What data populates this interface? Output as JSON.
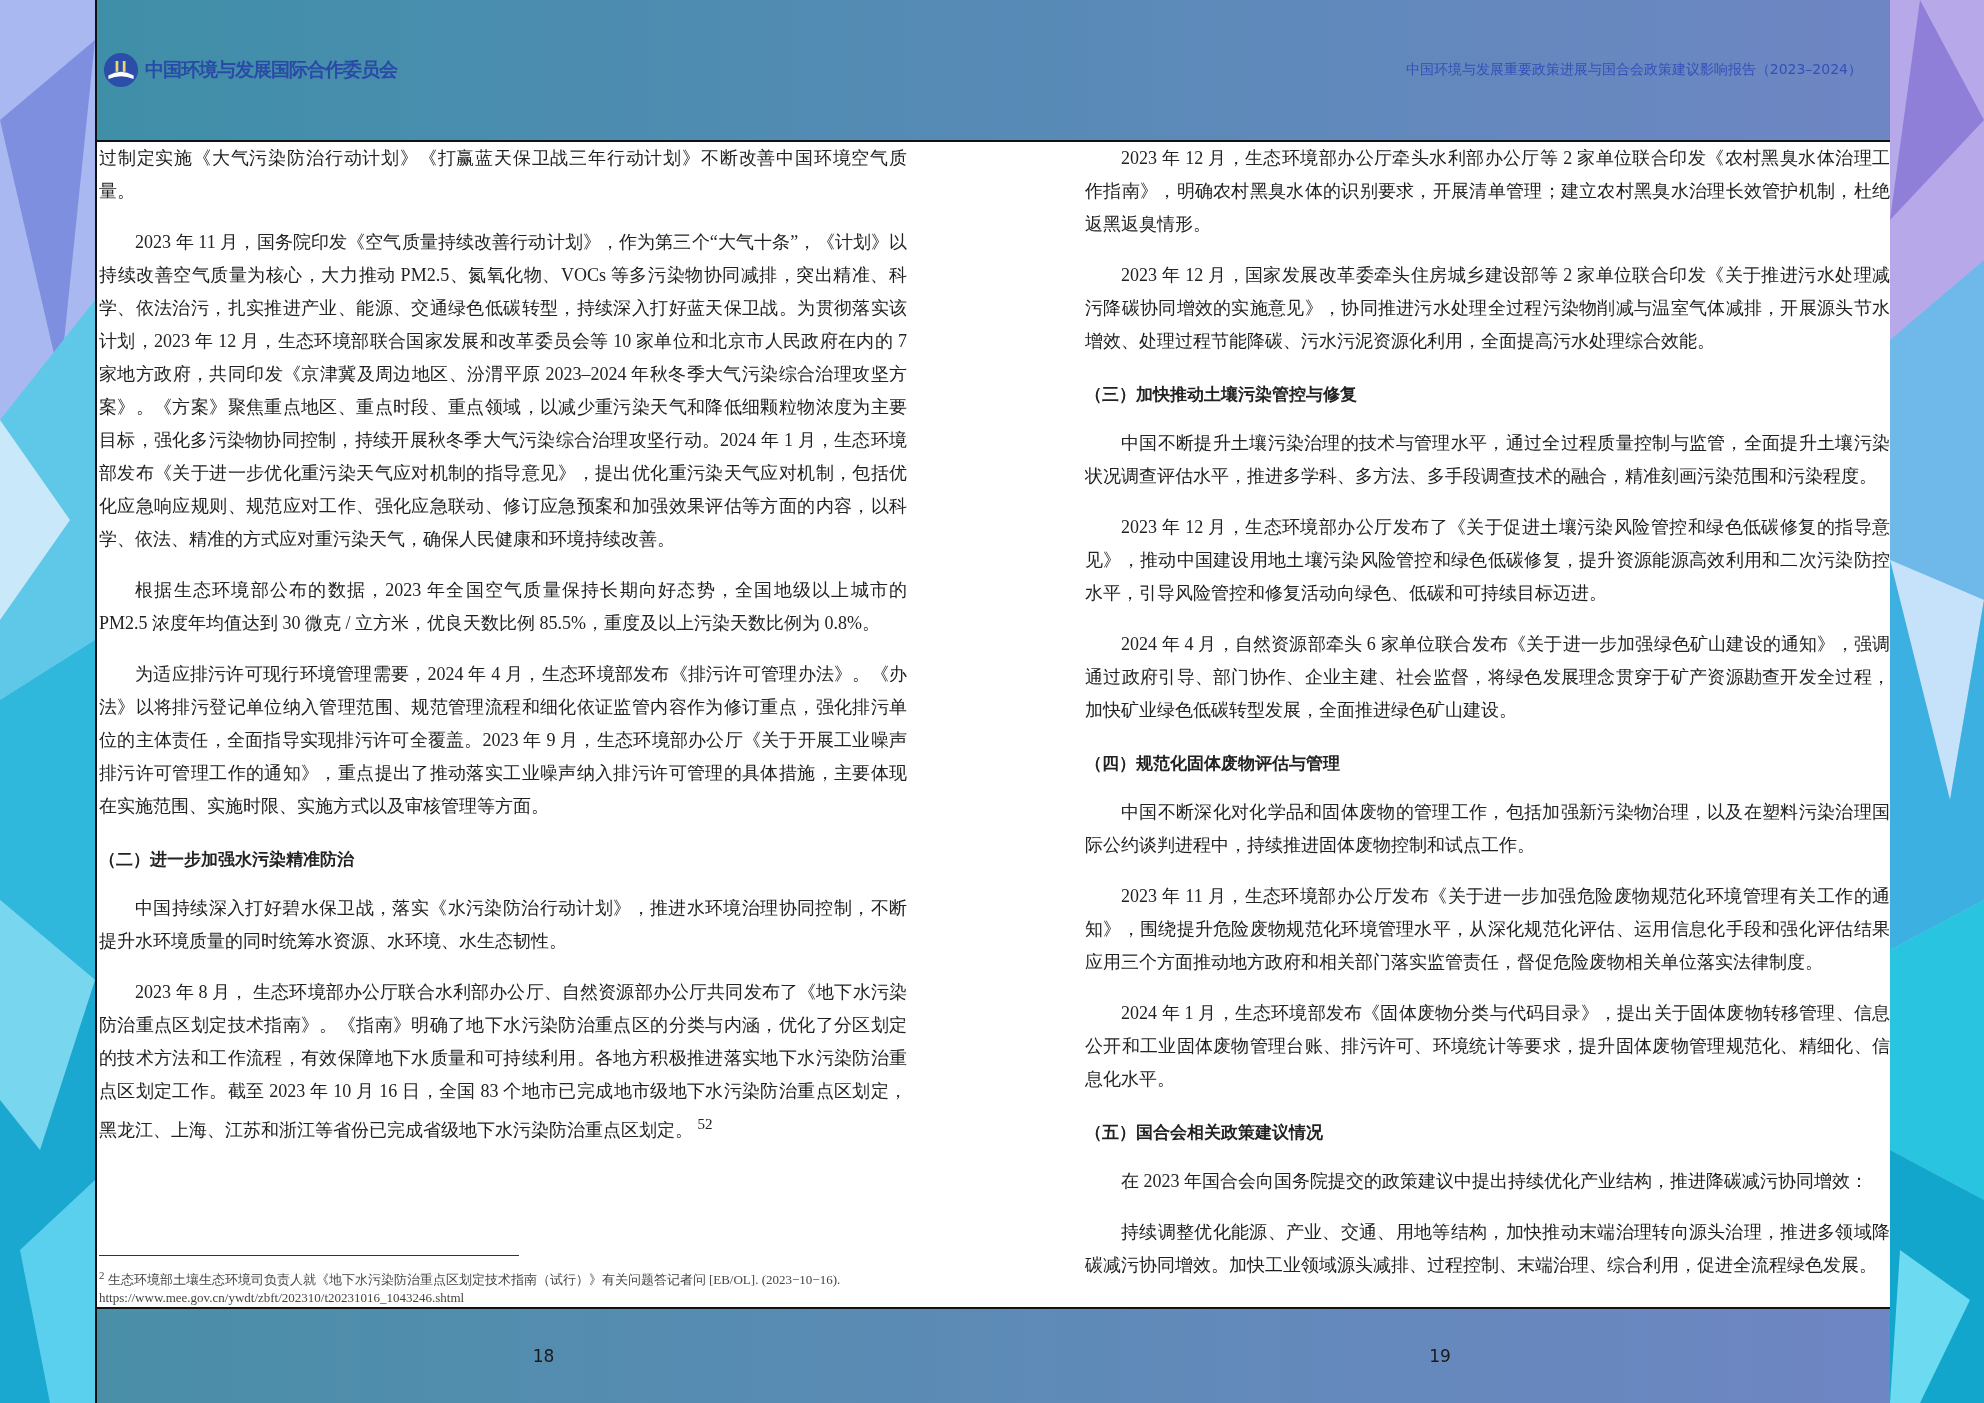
{
  "header": {
    "logo_text": "中国环境与发展国际合作委员会",
    "report_title": "中国环境与发展重要政策进展与国合会政策建议影响报告（2023–2024）"
  },
  "pages": [
    {
      "number": "18",
      "blocks": [
        {
          "kind": "continuation",
          "text": "过制定实施《大气污染防治行动计划》《打赢蓝天保卫战三年行动计划》不断改善中国环境空气质量。"
        },
        {
          "kind": "paragraph",
          "text": "2023 年 11 月，国务院印发《空气质量持续改善行动计划》，作为第三个“大气十条”，《计划》以持续改善空气质量为核心，大力推动 PM2.5、氮氧化物、VOCs 等多污染物协同减排，突出精准、科学、依法治污，扎实推进产业、能源、交通绿色低碳转型，持续深入打好蓝天保卫战。为贯彻落实该计划，2023 年 12 月，生态环境部联合国家发展和改革委员会等 10 家单位和北京市人民政府在内的 7 家地方政府，共同印发《京津冀及周边地区、汾渭平原 2023–2024 年秋冬季大气污染综合治理攻坚方案》。《方案》聚焦重点地区、重点时段、重点领域，以减少重污染天气和降低细颗粒物浓度为主要目标，强化多污染物协同控制，持续开展秋冬季大气污染综合治理攻坚行动。2024 年 1 月，生态环境部发布《关于进一步优化重污染天气应对机制的指导意见》，提出优化重污染天气应对机制，包括优化应急响应规则、规范应对工作、强化应急联动、修订应急预案和加强效果评估等方面的内容，以科学、依法、精准的方式应对重污染天气，确保人民健康和环境持续改善。"
        },
        {
          "kind": "paragraph",
          "text": "根据生态环境部公布的数据，2023 年全国空气质量保持长期向好态势，全国地级以上城市的 PM2.5 浓度年均值达到 30 微克 / 立方米，优良天数比例 85.5%，重度及以上污染天数比例为 0.8%。"
        },
        {
          "kind": "paragraph",
          "text": "为适应排污许可现行环境管理需要，2024 年 4 月，生态环境部发布《排污许可管理办法》。《办法》以将排污登记单位纳入管理范围、规范管理流程和细化依证监管内容作为修订重点，强化排污单位的主体责任，全面指导实现排污许可全覆盖。2023 年 9 月，生态环境部办公厅《关于开展工业噪声排污许可管理工作的通知》，重点提出了推动落实工业噪声纳入排污许可管理的具体措施，主要体现在实施范围、实施时限、实施方式以及审核管理等方面。"
        },
        {
          "kind": "heading",
          "text": "（二）进一步加强水污染精准防治"
        },
        {
          "kind": "paragraph",
          "text": "中国持续深入打好碧水保卫战，落实《水污染防治行动计划》，推进水环境治理协同控制，不断提升水环境质量的同时统筹水资源、水环境、水生态韧性。"
        },
        {
          "kind": "paragraph",
          "text": "2023 年 8 月， 生态环境部办公厅联合水利部办公厅、自然资源部办公厅共同发布了《地下水污染防治重点区划定技术指南》。《指南》明确了地下水污染防治重点区的分类与内涵，优化了分区划定的技术方法和工作流程，有效保障地下水质量和可持续利用。各地方积极推进落实地下水污染防治重点区划定工作。截至 2023 年 10 月 16 日，全国 83 个地市已完成地市级地下水污染防治重点区划定，黑龙江、上海、江苏和浙江等省份已完成省级地下水污染防治重点区划定。 $^{52}$"
        }
      ],
      "footnote": {
        "text": "$^{2}$ 生态环境部土壤生态环境司负责人就《地下水污染防治重点区划定技术指南（试行）》有关问题答记者问 [EB/OL]. (2023−10−16).",
        "link": "https://www.mee.gov.cn/ywdt/zbft/202310/t20231016_1043246.shtml"
      }
    },
    {
      "number": "19",
      "blocks": [
        {
          "kind": "paragraph",
          "text": "2023 年 12 月，生态环境部办公厅牵头水利部办公厅等 2 家单位联合印发《农村黑臭水体治理工作指南》，明确农村黑臭水体的识别要求，开展清单管理；建立农村黑臭水治理长效管护机制，杜绝返黑返臭情形。"
        },
        {
          "kind": "paragraph",
          "text": "2023 年 12 月，国家发展改革委牵头住房城乡建设部等 2 家单位联合印发《关于推进污水处理减污降碳协同增效的实施意见》，协同推进污水处理全过程污染物削减与温室气体减排，开展源头节水增效、处理过程节能降碳、污水污泥资源化利用，全面提高污水处理综合效能。"
        },
        {
          "kind": "heading",
          "text": "（三）加快推动土壤污染管控与修复"
        },
        {
          "kind": "paragraph",
          "text": "中国不断提升土壤污染治理的技术与管理水平，通过全过程质量控制与监管，全面提升土壤污染状况调查评估水平，推进多学科、多方法、多手段调查技术的融合，精准刻画污染范围和污染程度。"
        },
        {
          "kind": "paragraph",
          "text": "2023 年 12 月，生态环境部办公厅发布了《关于促进土壤污染风险管控和绿色低碳修复的指导意见》，推动中国建设用地土壤污染风险管控和绿色低碳修复，提升资源能源高效利用和二次污染防控水平，引导风险管控和修复活动向绿色、低碳和可持续目标迈进。"
        },
        {
          "kind": "paragraph",
          "text": "2024 年 4 月，自然资源部牵头 6 家单位联合发布《关于进一步加强绿色矿山建设的通知》，强调通过政府引导、部门协作、企业主建、社会监督，将绿色发展理念贯穿于矿产资源勘查开发全过程，加快矿业绿色低碳转型发展，全面推进绿色矿山建设。"
        },
        {
          "kind": "heading",
          "text": "（四）规范化固体废物评估与管理"
        },
        {
          "kind": "paragraph",
          "text": "中国不断深化对化学品和固体废物的管理工作，包括加强新污染物治理，以及在塑料污染治理国际公约谈判进程中，持续推进固体废物控制和试点工作。"
        },
        {
          "kind": "paragraph",
          "text": "2023 年 11 月，生态环境部办公厅发布《关于进一步加强危险废物规范化环境管理有关工作的通知》，围绕提升危险废物规范化环境管理水平，从深化规范化评估、运用信息化手段和强化评估结果应用三个方面推动地方政府和相关部门落实监管责任，督促危险废物相关单位落实法律制度。"
        },
        {
          "kind": "paragraph",
          "text": "2024 年 1 月，生态环境部发布《固体废物分类与代码目录》，提出关于固体废物转移管理、信息公开和工业固体废物管理台账、排污许可、环境统计等要求，提升固体废物管理规范化、精细化、信息化水平。"
        },
        {
          "kind": "heading",
          "text": "（五）国合会相关政策建议情况"
        },
        {
          "kind": "paragraph",
          "text": "在 2023 年国合会向国务院提交的政策建议中提出持续优化产业结构，推进降碳减污协同增效："
        },
        {
          "kind": "paragraph",
          "text": "持续调整优化能源、产业、交通、用地等结构，加快推动末端治理转向源头治理，推进多领域降碳减污协同增效。加快工业领域源头减排、过程控制、末端治理、综合利用，促进全流程绿色发展。"
        }
      ]
    }
  ]
}
